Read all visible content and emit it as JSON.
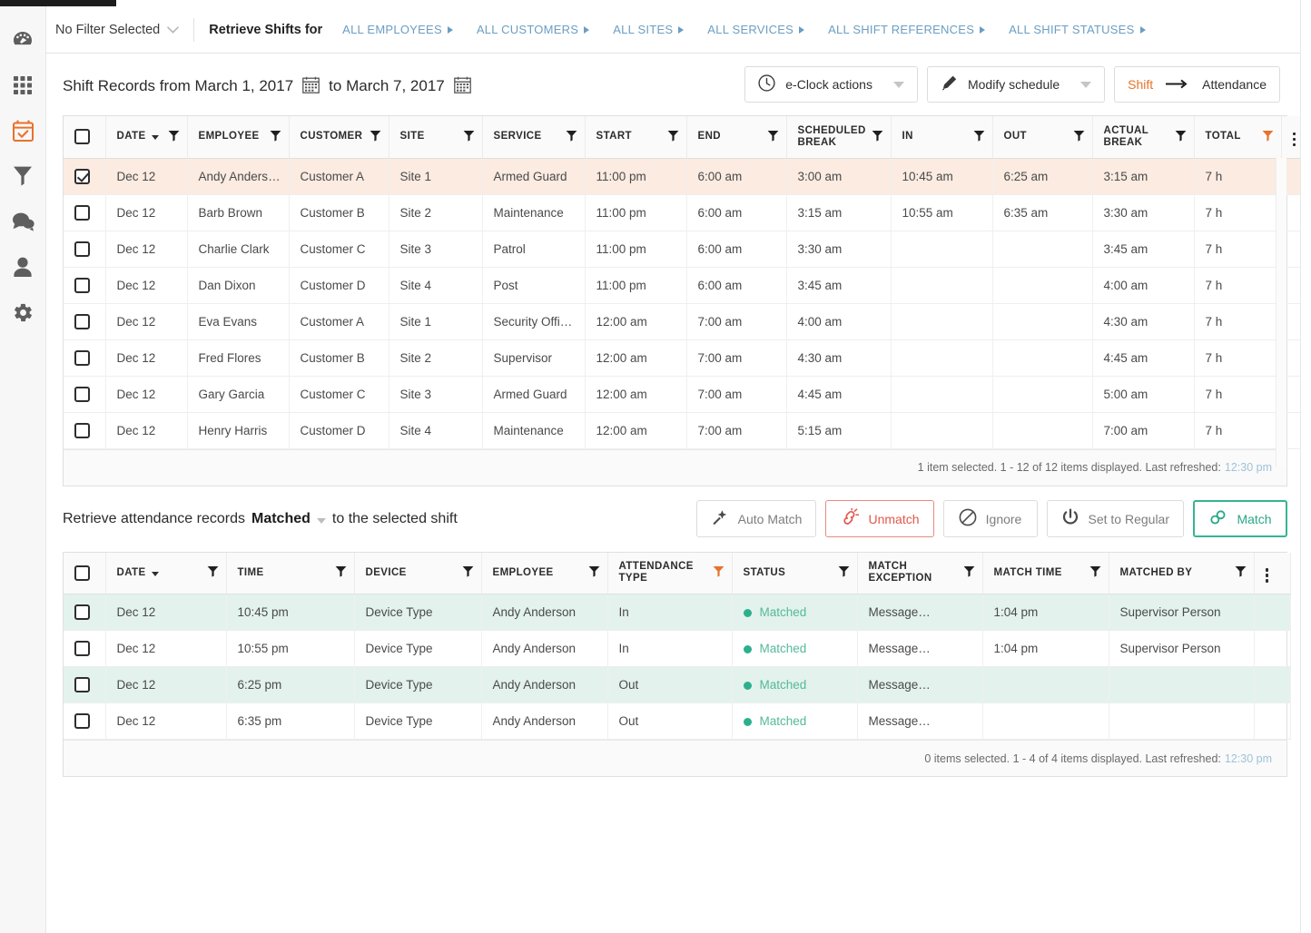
{
  "sidebar": {
    "items": [
      {
        "name": "dashboard",
        "icon": "gauge-icon",
        "active": false
      },
      {
        "name": "apps",
        "icon": "grid-icon",
        "active": false
      },
      {
        "name": "schedule",
        "icon": "calendar-check-icon",
        "active": true
      },
      {
        "name": "filters",
        "icon": "funnel-icon",
        "active": false
      },
      {
        "name": "messages",
        "icon": "chat-bubbles-icon",
        "active": false
      },
      {
        "name": "profile",
        "icon": "person-icon",
        "active": false
      },
      {
        "name": "settings",
        "icon": "gear-icon",
        "active": false
      }
    ]
  },
  "header": {
    "filter_selected": "No Filter Selected",
    "retrieve_label": "Retrieve Shifts for",
    "nav_links": [
      "ALL EMPLOYEES",
      "ALL CUSTOMERS",
      "ALL SITES",
      "ALL SERVICES",
      "ALL SHIFT REFERENCES",
      "ALL SHIFT STATUSES"
    ]
  },
  "subheader": {
    "range_prefix": "Shift Records from March 1, 2017",
    "range_mid": "to March 7, 2017",
    "eclock_label": "e-Clock actions",
    "modify_label": "Modify schedule",
    "toggle_shift": "Shift",
    "toggle_arrow": "⟶",
    "toggle_attendance": "Attendance"
  },
  "shift_grid": {
    "columns": [
      {
        "label": "DATE",
        "sorted": true,
        "filter": "default"
      },
      {
        "label": "EMPLOYEE",
        "sorted": false,
        "filter": "default"
      },
      {
        "label": "CUSTOMER",
        "sorted": false,
        "filter": "default"
      },
      {
        "label": "SITE",
        "sorted": false,
        "filter": "default"
      },
      {
        "label": "SERVICE",
        "sorted": false,
        "filter": "default"
      },
      {
        "label": "START",
        "sorted": false,
        "filter": "default"
      },
      {
        "label": "END",
        "sorted": false,
        "filter": "default"
      },
      {
        "label": "SCHEDULED BREAK",
        "sorted": false,
        "filter": "default"
      },
      {
        "label": "IN",
        "sorted": false,
        "filter": "default"
      },
      {
        "label": "OUT",
        "sorted": false,
        "filter": "default"
      },
      {
        "label": "ACTUAL BREAK",
        "sorted": false,
        "filter": "default"
      },
      {
        "label": "TOTAL",
        "sorted": false,
        "filter": "active"
      }
    ],
    "rows": [
      {
        "selected": true,
        "date": "Dec 12",
        "employee": "Andy Anderson",
        "customer": "Customer A",
        "site": "Site 1",
        "service": "Armed Guard",
        "start": "11:00 pm",
        "end": "6:00 am",
        "scheduled_break": "3:00 am",
        "in": "10:45 am",
        "out": "6:25 am",
        "actual_break": "3:15 am",
        "total": "7 h"
      },
      {
        "selected": false,
        "date": "Dec 12",
        "employee": "Barb Brown",
        "customer": "Customer B",
        "site": "Site 2",
        "service": "Maintenance",
        "start": "11:00 pm",
        "end": "6:00 am",
        "scheduled_break": "3:15 am",
        "in": "10:55 am",
        "out": "6:35 am",
        "actual_break": "3:30 am",
        "total": "7 h"
      },
      {
        "selected": false,
        "date": "Dec 12",
        "employee": "Charlie Clark",
        "customer": "Customer C",
        "site": "Site 3",
        "service": "Patrol",
        "start": "11:00 pm",
        "end": "6:00 am",
        "scheduled_break": "3:30 am",
        "in": "",
        "out": "",
        "actual_break": "3:45 am",
        "total": "7 h"
      },
      {
        "selected": false,
        "date": "Dec 12",
        "employee": "Dan Dixon",
        "customer": "Customer D",
        "site": "Site 4",
        "service": "Post",
        "start": "11:00 pm",
        "end": "6:00 am",
        "scheduled_break": "3:45 am",
        "in": "",
        "out": "",
        "actual_break": "4:00 am",
        "total": "7 h"
      },
      {
        "selected": false,
        "date": "Dec 12",
        "employee": "Eva Evans",
        "customer": "Customer A",
        "site": "Site 1",
        "service": "Security Officer",
        "start": "12:00 am",
        "end": "7:00 am",
        "scheduled_break": "4:00 am",
        "in": "",
        "out": "",
        "actual_break": "4:30 am",
        "total": "7 h"
      },
      {
        "selected": false,
        "date": "Dec 12",
        "employee": "Fred Flores",
        "customer": "Customer B",
        "site": "Site 2",
        "service": "Supervisor",
        "start": "12:00 am",
        "end": "7:00 am",
        "scheduled_break": "4:30 am",
        "in": "",
        "out": "",
        "actual_break": "4:45 am",
        "total": "7 h"
      },
      {
        "selected": false,
        "date": "Dec 12",
        "employee": "Gary Garcia",
        "customer": "Customer C",
        "site": "Site 3",
        "service": "Armed Guard",
        "start": "12:00 am",
        "end": "7:00 am",
        "scheduled_break": "4:45 am",
        "in": "",
        "out": "",
        "actual_break": "5:00 am",
        "total": "7 h"
      },
      {
        "selected": false,
        "date": "Dec 12",
        "employee": "Henry Harris",
        "customer": "Customer D",
        "site": "Site 4",
        "service": "Maintenance",
        "start": "12:00 am",
        "end": "7:00 am",
        "scheduled_break": "5:15 am",
        "in": "",
        "out": "",
        "actual_break": "7:00 am",
        "total": "7 h"
      }
    ],
    "footer_text": "1 item selected. 1 - 12 of 12 items displayed. Last refreshed:",
    "footer_time": "12:30 pm"
  },
  "attendance": {
    "title_prefix": "Retrieve attendance records",
    "title_mode": "Matched",
    "title_suffix": "to the selected shift",
    "buttons": [
      {
        "label": "Auto Match",
        "icon": "magic-wand-icon",
        "style": "default"
      },
      {
        "label": "Unmatch",
        "icon": "broken-link-icon",
        "style": "danger"
      },
      {
        "label": "Ignore",
        "icon": "block-icon",
        "style": "default"
      },
      {
        "label": "Set to Regular",
        "icon": "power-icon",
        "style": "default"
      },
      {
        "label": "Match",
        "icon": "link-icon",
        "style": "primary"
      }
    ],
    "columns": [
      {
        "label": "DATE",
        "sorted": true,
        "filter": "default"
      },
      {
        "label": "TIME",
        "sorted": false,
        "filter": "default"
      },
      {
        "label": "DEVICE",
        "sorted": false,
        "filter": "default"
      },
      {
        "label": "EMPLOYEE",
        "sorted": false,
        "filter": "default"
      },
      {
        "label": "ATTENDANCE TYPE",
        "sorted": false,
        "filter": "active"
      },
      {
        "label": "STATUS",
        "sorted": false,
        "filter": "default"
      },
      {
        "label": "MATCH EXCEPTION",
        "sorted": false,
        "filter": "default"
      },
      {
        "label": "MATCH TIME",
        "sorted": false,
        "filter": "default"
      },
      {
        "label": "MATCHED BY",
        "sorted": false,
        "filter": "default"
      }
    ],
    "rows": [
      {
        "highlight": true,
        "date": "Dec 12",
        "time": "10:45 pm",
        "device": "Device Type",
        "employee": "Andy Anderson",
        "type": "In",
        "status": "Matched",
        "exception": "Message…",
        "match_time": "1:04 pm",
        "matched_by": "Supervisor Person"
      },
      {
        "highlight": false,
        "date": "Dec 12",
        "time": "10:55 pm",
        "device": "Device Type",
        "employee": "Andy Anderson",
        "type": "In",
        "status": "Matched",
        "exception": "Message…",
        "match_time": "1:04 pm",
        "matched_by": "Supervisor Person"
      },
      {
        "highlight": true,
        "date": "Dec 12",
        "time": "6:25 pm",
        "device": "Device Type",
        "employee": "Andy Anderson",
        "type": "Out",
        "status": "Matched",
        "exception": "Message…",
        "match_time": "",
        "matched_by": ""
      },
      {
        "highlight": false,
        "date": "Dec 12",
        "time": "6:35 pm",
        "device": "Device Type",
        "employee": "Andy Anderson",
        "type": "Out",
        "status": "Matched",
        "exception": "Message…",
        "match_time": "",
        "matched_by": ""
      }
    ],
    "footer_text": "0 items selected. 1 - 4 of 4 items displayed. Last refreshed:",
    "footer_time": "12:30 pm"
  },
  "colors": {
    "accent_orange": "#e8722a",
    "link_blue": "#6b9ec2",
    "teal": "#2bb08d",
    "danger_red": "#e2574c",
    "selected_row": "#fbebe1",
    "highlight_row": "#e3f2ec"
  }
}
